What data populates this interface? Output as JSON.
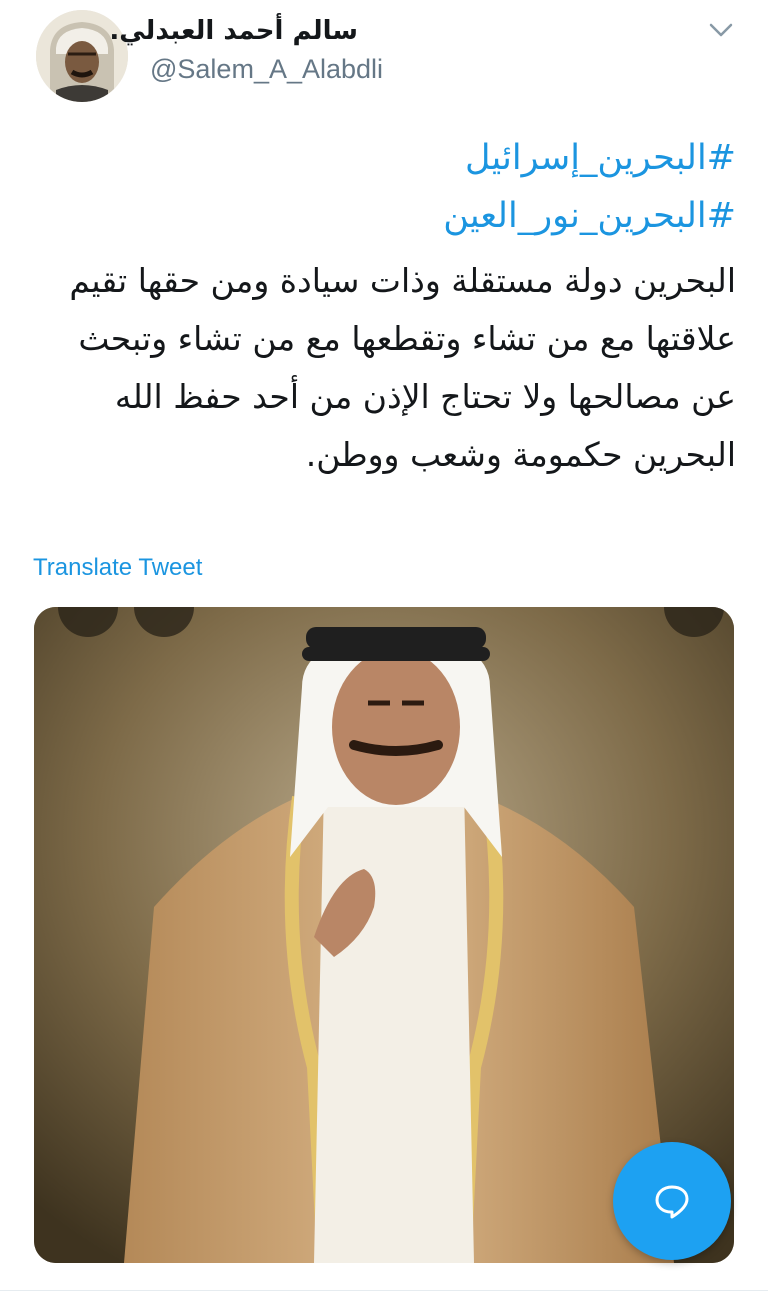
{
  "tweet": {
    "author": {
      "display_name": "سالم أحمد العبدلي.",
      "handle": "@Salem_A_Alabdli",
      "avatar_icon": "profile-photo"
    },
    "menu_icon": "chevron-down-icon",
    "hashtags": [
      "#البحرين_إسرائيل",
      "#البحرين_نور_العين"
    ],
    "body": "البحرين دولة مستقلة وذات سيادة ومن حقها تقيم علاقتها مع من تشاء وتقطعها مع من تشاء وتبحث عن مصالحها ولا تحتاج الإذن من أحد حفظ الله البحرين حكمومة وشعب ووطن.",
    "translate_label": "Translate Tweet",
    "media": {
      "kind": "photo"
    }
  },
  "actions": {
    "compose_icon": "reply-bubble-icon"
  },
  "colors": {
    "link_blue": "#1b95e0",
    "fab_blue": "#1da1f2",
    "text": "#14171a",
    "muted": "#657786"
  }
}
